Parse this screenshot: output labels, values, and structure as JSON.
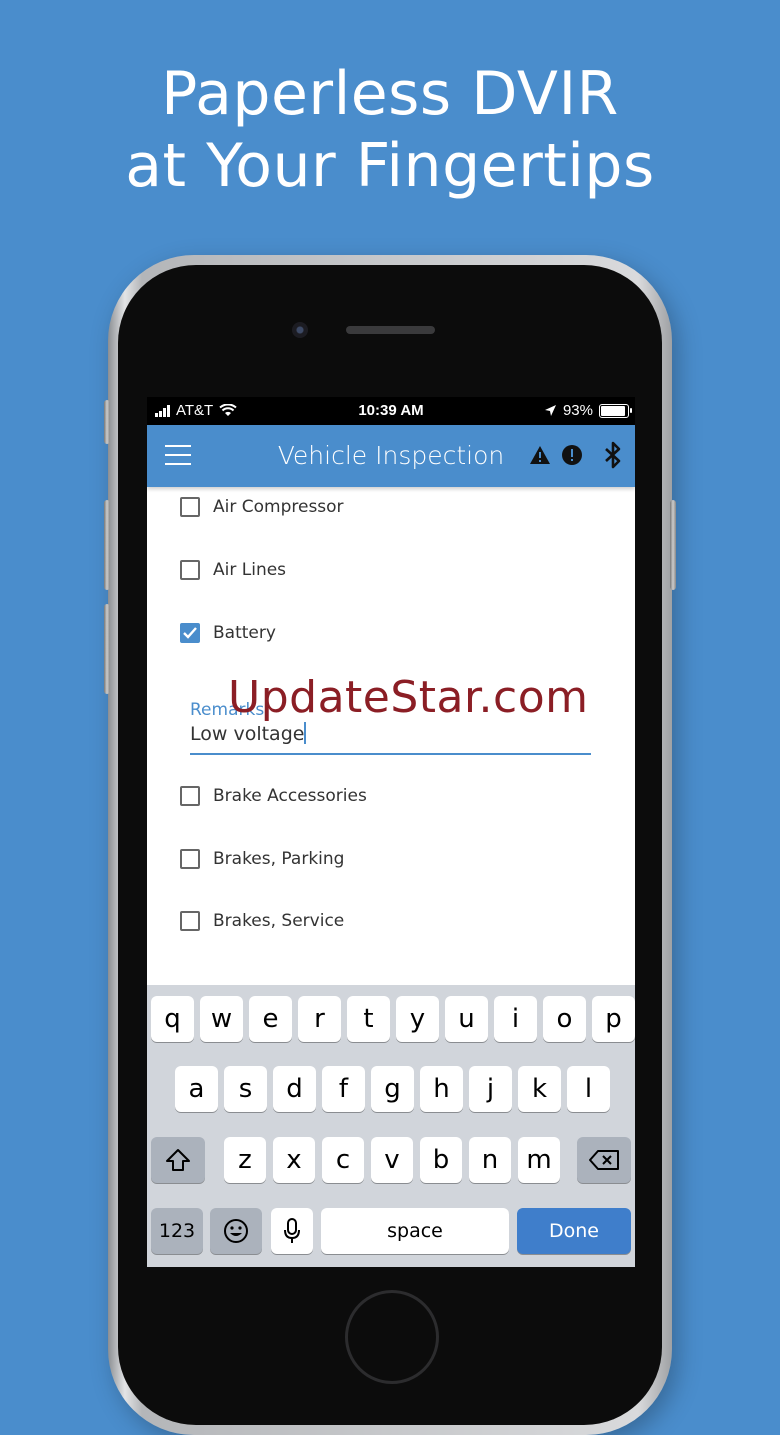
{
  "headline": {
    "line1": "Paperless DVIR",
    "line2": "at Your Fingertips"
  },
  "status_bar": {
    "carrier": "AT&T",
    "time": "10:39 AM",
    "battery": "93%",
    "battery_level": 0.93
  },
  "app_bar": {
    "title": "Vehicle Inspection",
    "icons": [
      "menu-icon",
      "warning-icon",
      "alert-circle-icon",
      "bluetooth-icon"
    ]
  },
  "checklist": [
    {
      "label": "Air Compressor",
      "checked": false
    },
    {
      "label": "Air Lines",
      "checked": false
    },
    {
      "label": "Battery",
      "checked": true
    },
    {
      "label": "Brake Accessories",
      "checked": false
    },
    {
      "label": "Brakes, Parking",
      "checked": false
    },
    {
      "label": "Brakes, Service",
      "checked": false
    }
  ],
  "remarks": {
    "label": "Remarks",
    "value": "Low voltage"
  },
  "watermark": "UpdateStar.com",
  "keyboard": {
    "row1": [
      "q",
      "w",
      "e",
      "r",
      "t",
      "y",
      "u",
      "i",
      "o",
      "p"
    ],
    "row2": [
      "a",
      "s",
      "d",
      "f",
      "g",
      "h",
      "j",
      "k",
      "l"
    ],
    "row3": [
      "z",
      "x",
      "c",
      "v",
      "b",
      "n",
      "m"
    ],
    "numbers_key": "123",
    "space_key": "space",
    "done_key": "Done"
  },
  "colors": {
    "background": "#4a8dcc",
    "accent": "#4a8dcc",
    "watermark": "#8b1e25"
  }
}
